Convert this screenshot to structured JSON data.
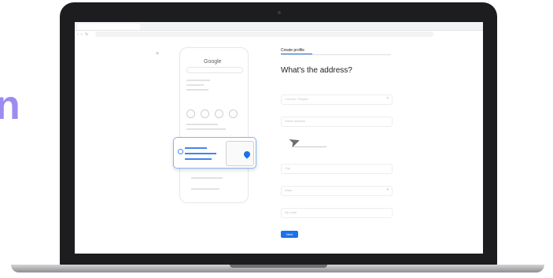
{
  "decoration": {
    "accent_letter": "n",
    "accent_color": "#9c8cf0"
  },
  "browser": {
    "nav_glyphs": "‹ › ↻"
  },
  "preview": {
    "close_glyph": "×",
    "brand": "Google"
  },
  "form": {
    "tab_label": "Create profile",
    "heading": "What's the address?",
    "fields": [
      {
        "placeholder": "Country / Region",
        "has_dropdown": true
      },
      {
        "placeholder": "Street address",
        "has_dropdown": false
      },
      {
        "placeholder": "City",
        "has_dropdown": false
      },
      {
        "placeholder": "State",
        "has_dropdown": true
      },
      {
        "placeholder": "Zip code",
        "has_dropdown": false
      }
    ],
    "next_label": "Next",
    "accent_color": "#1a73e8"
  }
}
